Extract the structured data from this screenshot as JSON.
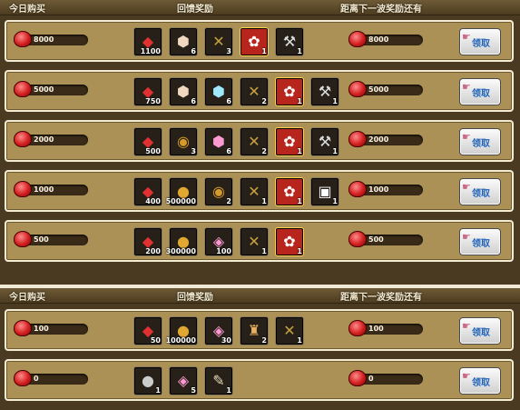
{
  "headers": [
    {
      "c1": "今日购买",
      "c2": "回馈奖励",
      "c3": "距离下一波奖励还有"
    },
    {
      "c1": "今日购买",
      "c2": "回馈奖励",
      "c3": "距离下一波奖励还有"
    }
  ],
  "tiers": [
    {
      "amount": "8000",
      "remain": "8000",
      "button": "领取",
      "items": [
        {
          "icon": "gem-icon",
          "count": "1100"
        },
        {
          "icon": "ore-icon",
          "count": "6"
        },
        {
          "icon": "bird-icon",
          "count": "3"
        },
        {
          "icon": "gift-box-icon",
          "count": "1"
        },
        {
          "icon": "axe-icon",
          "count": "1"
        }
      ]
    },
    {
      "amount": "5000",
      "remain": "5000",
      "button": "领取",
      "items": [
        {
          "icon": "gem-icon",
          "count": "750"
        },
        {
          "icon": "ore-icon",
          "count": "6"
        },
        {
          "icon": "crystal-icon",
          "count": "6"
        },
        {
          "icon": "bird-icon",
          "count": "2"
        },
        {
          "icon": "gift-box-icon",
          "count": "1"
        },
        {
          "icon": "axe-icon",
          "count": "1"
        }
      ]
    },
    {
      "amount": "2000",
      "remain": "2000",
      "button": "领取",
      "items": [
        {
          "icon": "gem-icon",
          "count": "500"
        },
        {
          "icon": "helmet-icon",
          "count": "3"
        },
        {
          "icon": "pink-ore-icon",
          "count": "6"
        },
        {
          "icon": "bird-icon",
          "count": "2"
        },
        {
          "icon": "gift-box-icon",
          "count": "1"
        },
        {
          "icon": "axe-icon",
          "count": "1"
        }
      ]
    },
    {
      "amount": "1000",
      "remain": "1000",
      "button": "领取",
      "items": [
        {
          "icon": "gem-icon",
          "count": "400"
        },
        {
          "icon": "gold-coin-icon",
          "count": "500000"
        },
        {
          "icon": "helmet-icon",
          "count": "2"
        },
        {
          "icon": "bird-icon",
          "count": "1"
        },
        {
          "icon": "gift-box-icon",
          "count": "1"
        },
        {
          "icon": "card-icon",
          "count": "1"
        }
      ]
    },
    {
      "amount": "500",
      "remain": "500",
      "button": "领取",
      "items": [
        {
          "icon": "gem-icon",
          "count": "200"
        },
        {
          "icon": "gold-coin-icon",
          "count": "300000"
        },
        {
          "icon": "pink-crystal-icon",
          "count": "100"
        },
        {
          "icon": "bird-icon",
          "count": "1"
        },
        {
          "icon": "gift-box-icon",
          "count": "1"
        }
      ]
    },
    {
      "amount": "100",
      "remain": "100",
      "button": "领取",
      "items": [
        {
          "icon": "gem-icon",
          "count": "50"
        },
        {
          "icon": "gold-coin-icon",
          "count": "100000"
        },
        {
          "icon": "pink-crystal-icon",
          "count": "30"
        },
        {
          "icon": "bag-icon",
          "count": "2"
        },
        {
          "icon": "bird-icon",
          "count": "1"
        }
      ]
    },
    {
      "amount": "0",
      "remain": "0",
      "button": "领取",
      "items": [
        {
          "icon": "bomb-icon",
          "count": "1"
        },
        {
          "icon": "pink-crystal-icon",
          "count": "5"
        },
        {
          "icon": "scroll-icon",
          "count": "1"
        }
      ]
    }
  ]
}
